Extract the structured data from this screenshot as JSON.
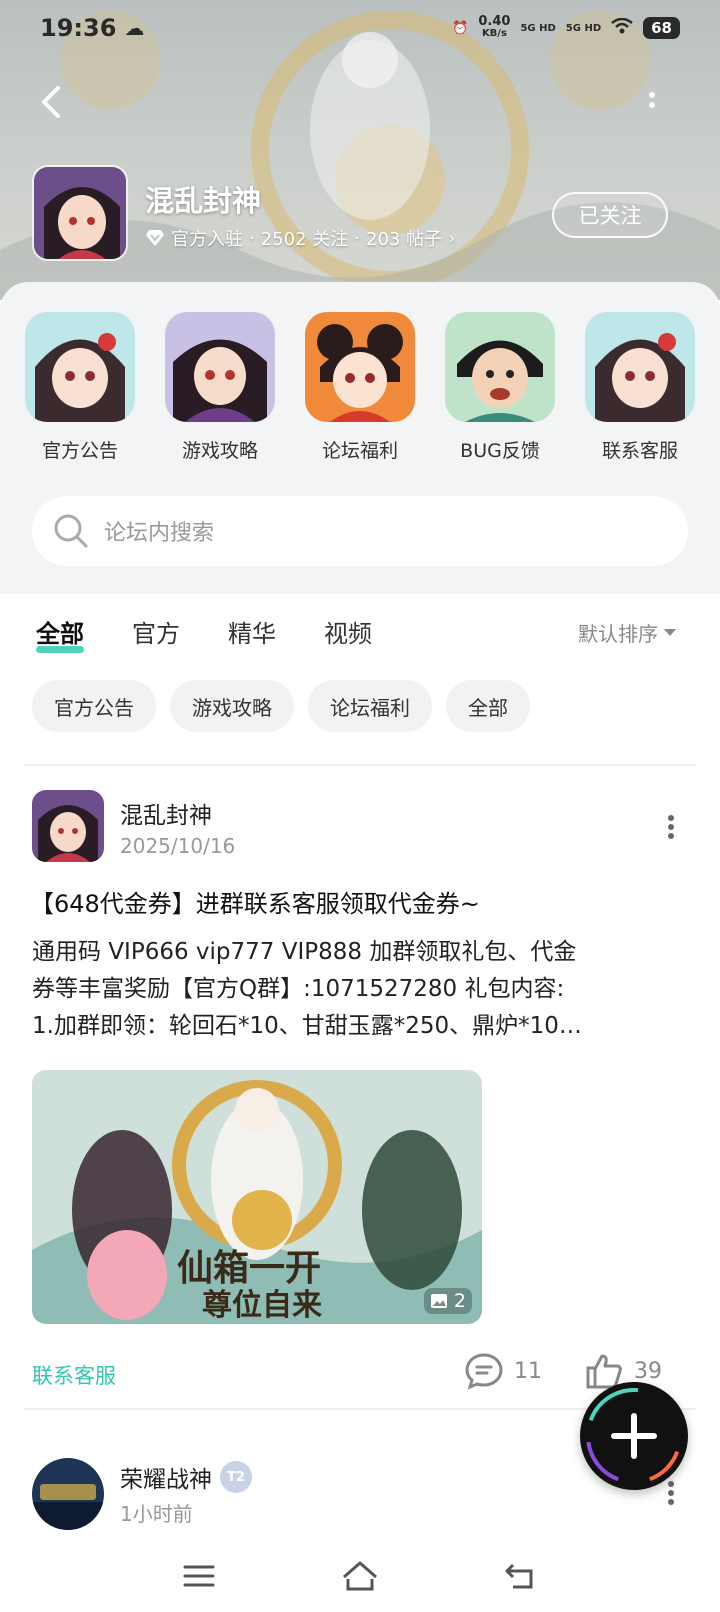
{
  "status_bar": {
    "time": "19:36",
    "net_speed": "0.40",
    "net_unit": "KB/s",
    "signal1": "5G HD",
    "signal2": "5G HD",
    "battery": "68"
  },
  "forum": {
    "title": "混乱封神",
    "verified_label": "官方入驻",
    "followers": "2502 关注",
    "posts": "203 帖子",
    "follow_label": "已关注"
  },
  "shortcuts": [
    {
      "label": "官方公告",
      "icon": "announcement-avatar"
    },
    {
      "label": "游戏攻略",
      "icon": "guide-avatar"
    },
    {
      "label": "论坛福利",
      "icon": "welfare-avatar"
    },
    {
      "label": "BUG反馈",
      "icon": "bug-avatar"
    },
    {
      "label": "联系客服",
      "icon": "service-avatar"
    }
  ],
  "search": {
    "placeholder": "论坛内搜索"
  },
  "tabs": [
    {
      "label": "全部",
      "active": true
    },
    {
      "label": "官方",
      "active": false
    },
    {
      "label": "精华",
      "active": false
    },
    {
      "label": "视频",
      "active": false
    }
  ],
  "sort": {
    "label": "默认排序"
  },
  "chips": [
    "官方公告",
    "游戏攻略",
    "论坛福利",
    "全部"
  ],
  "post": {
    "author": "混乱封神",
    "date": "2025/10/16",
    "title": "【648代金券】进群联系客服领取代金券~",
    "body_line1": "通用码 VIP666 vip777 VIP888 加群领取礼包、代金",
    "body_line2": "券等丰富奖励【官方Q群】:1071527280  礼包内容:",
    "body_line3": "1.加群即领：轮回石*10、甘甜玉露*250、鼎炉*10…",
    "image_text_line1": "仙箱一开",
    "image_text_line2": "尊位自来",
    "image_count": "2",
    "tag": "联系客服",
    "comments": "11",
    "likes": "39"
  },
  "post2": {
    "author": "荣耀战神",
    "level": "T2",
    "time": "1小时前"
  },
  "colors": {
    "accent": "#4fd2c2",
    "tag": "#36c4b4",
    "panel_bg": "#f3f4f6"
  }
}
